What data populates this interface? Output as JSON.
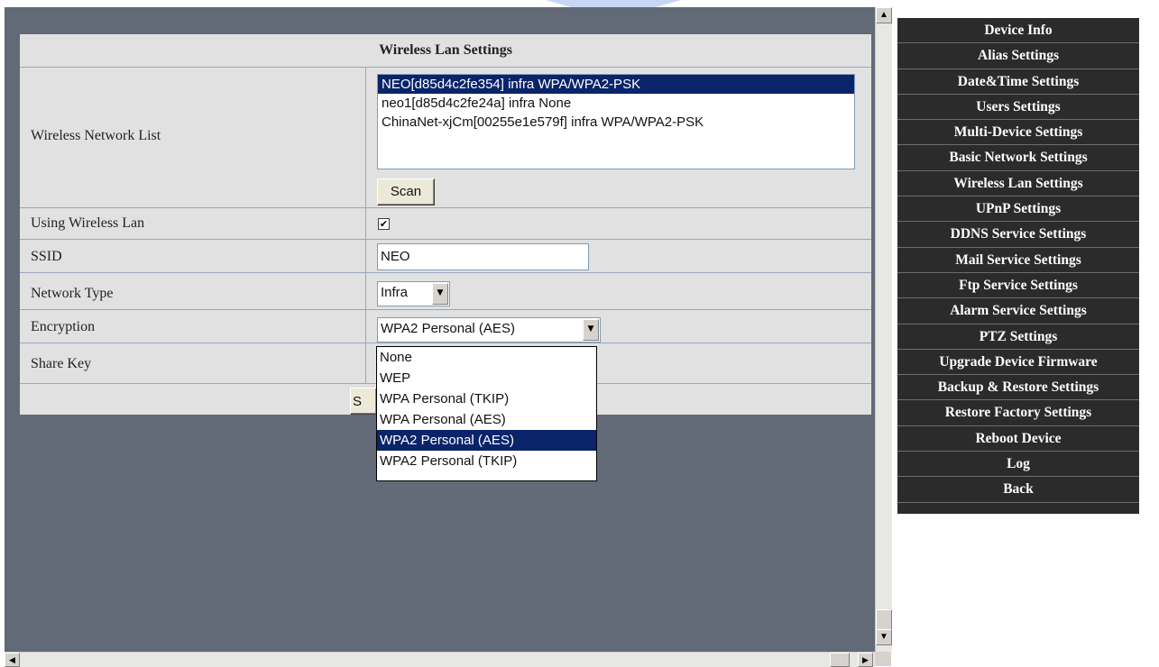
{
  "panel": {
    "title": "Wireless Lan Settings",
    "network_list_label": "Wireless Network List",
    "networks": [
      "NEO[d85d4c2fe354] infra WPA/WPA2-PSK",
      "neo1[d85d4c2fe24a] infra None",
      "ChinaNet-xjCm[00255e1e579f] infra WPA/WPA2-PSK"
    ],
    "selected_network_index": 0,
    "scan_label": "Scan",
    "using_wireless_label": "Using Wireless Lan",
    "using_wireless_checked": true,
    "check_glyph": "✔",
    "ssid_label": "SSID",
    "ssid_value": "NEO",
    "network_type_label": "Network Type",
    "network_type_value": "Infra",
    "encryption_label": "Encryption",
    "encryption_value": "WPA2 Personal (AES)",
    "share_key_label": "Share Key",
    "save_label": "S",
    "encryption_options": [
      "None",
      "WEP",
      "WPA Personal (TKIP)",
      "WPA Personal (AES)",
      "WPA2 Personal (AES)",
      "WPA2 Personal (TKIP)"
    ],
    "selected_encryption_index": 4
  },
  "menu": {
    "items": [
      "Device Info",
      "Alias Settings",
      "Date&Time Settings",
      "Users Settings",
      "Multi-Device Settings",
      "Basic Network Settings",
      "Wireless Lan Settings",
      "UPnP Settings",
      "DDNS Service Settings",
      "Mail Service Settings",
      "Ftp Service Settings",
      "Alarm Service Settings",
      "PTZ Settings",
      "Upgrade Device Firmware",
      "Backup & Restore Settings",
      "Restore Factory Settings",
      "Reboot Device",
      "Log",
      "Back"
    ]
  },
  "icons": {
    "dropdown_arrow": "▼",
    "scroll_up": "▲",
    "scroll_down": "▼",
    "scroll_left": "◀",
    "scroll_right": "▶"
  },
  "colors": {
    "frame_bg": "#626977",
    "panel_bg": "#e1e1e1",
    "selection": "#0a246a",
    "menu_bg": "#2b2b2b"
  }
}
